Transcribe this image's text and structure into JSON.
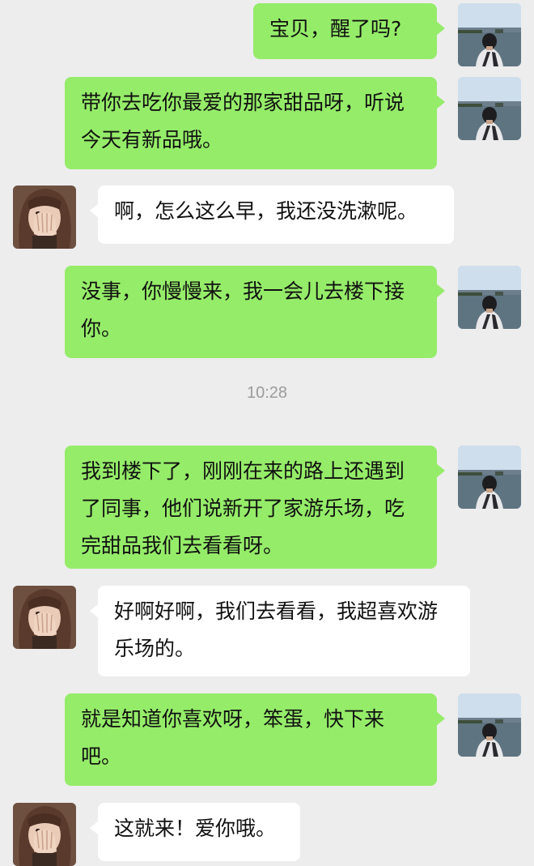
{
  "chat": {
    "messages": [
      {
        "sender": "me",
        "text": "宝贝，醒了吗?"
      },
      {
        "sender": "me",
        "text": "带你去吃你最爱的那家甜品呀，听说今天有新品哦。"
      },
      {
        "sender": "her",
        "text": "啊，怎么这么早，我还没洗漱呢。"
      },
      {
        "sender": "me",
        "text": "没事，你慢慢来，我一会儿去楼下接你。"
      },
      {
        "sender": "me",
        "text": "我到楼下了，刚刚在来的路上还遇到了同事，他们说新开了家游乐场，吃完甜品我们去看看呀。"
      },
      {
        "sender": "her",
        "text": "好啊好啊，我们去看看，我超喜欢游乐场的。"
      },
      {
        "sender": "me",
        "text": "就是知道你喜欢呀，笨蛋，快下来吧。"
      },
      {
        "sender": "her",
        "text": "这就来！爱你哦。"
      }
    ],
    "timestamp": "10:28"
  },
  "colors": {
    "background": "#ededed",
    "my_bubble": "#95ec69",
    "her_bubble": "#ffffff",
    "text": "#111111",
    "timestamp": "#9b9b9b"
  },
  "icons": {
    "my_avatar": "man-by-lake-avatar",
    "her_avatar": "girl-covering-face-avatar"
  }
}
